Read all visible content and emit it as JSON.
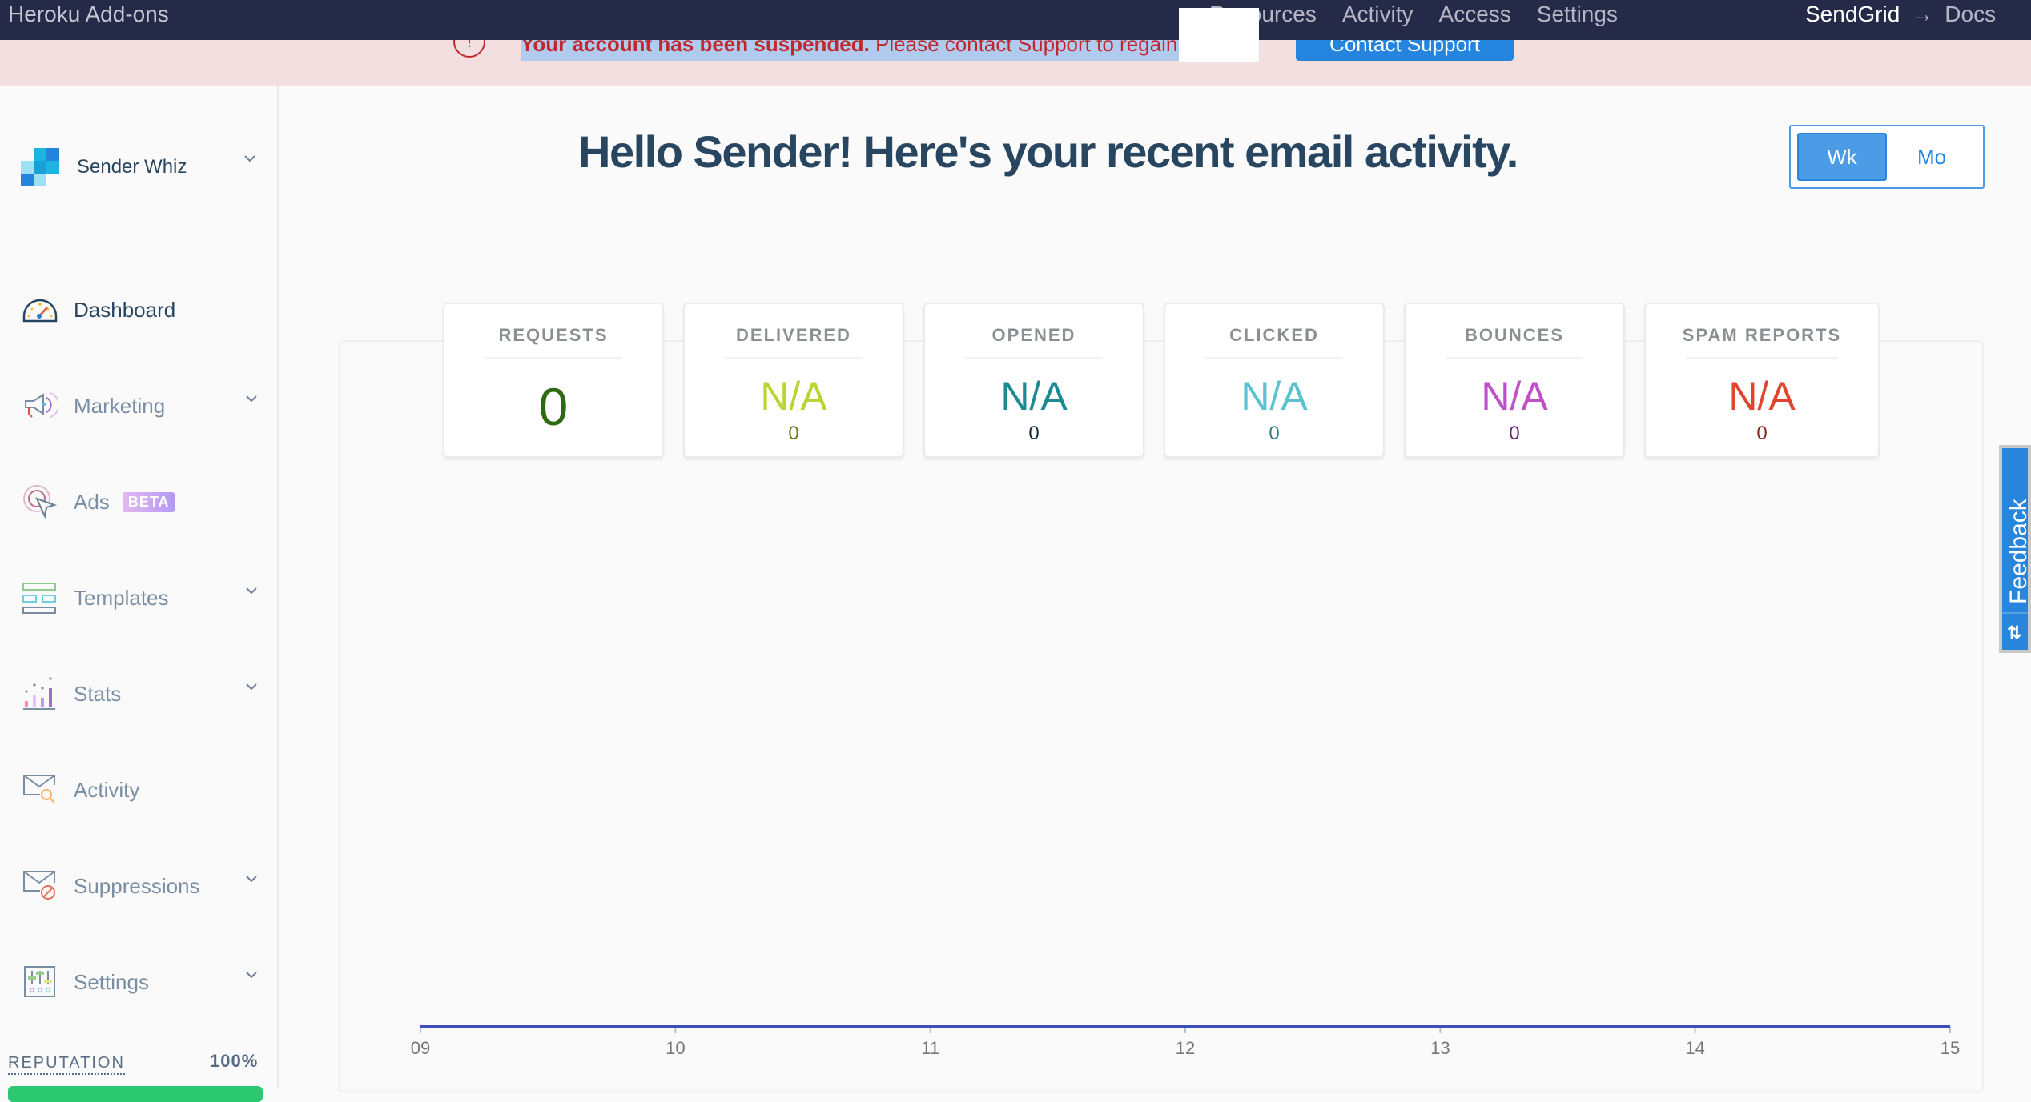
{
  "topbar": {
    "brand": "Heroku Add-ons",
    "nav": [
      "Resources",
      "Activity",
      "Access",
      "Settings"
    ],
    "arrow": "→",
    "addon": "SendGrid",
    "docs": "Docs"
  },
  "banner": {
    "message_bold": "Your account has been suspended.",
    "message_rest": " Please contact Support to regain",
    "contact_button": "Contact Support"
  },
  "sidebar": {
    "account_name": "Sender Whiz",
    "items": [
      {
        "label": "Dashboard",
        "icon": "gauge-icon",
        "active": true,
        "expandable": false
      },
      {
        "label": "Marketing",
        "icon": "megaphone-icon",
        "active": false,
        "expandable": true
      },
      {
        "label": "Ads",
        "icon": "target-cursor-icon",
        "active": false,
        "expandable": false,
        "badge": "BETA"
      },
      {
        "label": "Templates",
        "icon": "template-icon",
        "active": false,
        "expandable": true
      },
      {
        "label": "Stats",
        "icon": "bar-chart-icon",
        "active": false,
        "expandable": true
      },
      {
        "label": "Activity",
        "icon": "mail-search-icon",
        "active": false,
        "expandable": false
      },
      {
        "label": "Suppressions",
        "icon": "mail-block-icon",
        "active": false,
        "expandable": true
      },
      {
        "label": "Settings",
        "icon": "sliders-icon",
        "active": false,
        "expandable": true
      }
    ],
    "reputation": {
      "label": "REPUTATION",
      "value": "100%",
      "percent": 100,
      "color": "#2bc771"
    }
  },
  "main": {
    "title": "Hello Sender! Here's your recent email activity.",
    "toggle": {
      "options": [
        "Wk",
        "Mo"
      ],
      "selected": "Wk"
    },
    "cards": [
      {
        "label": "REQUESTS",
        "value": "0",
        "count": null,
        "color": "#2d6a12"
      },
      {
        "label": "DELIVERED",
        "value": "N/A",
        "count": "0",
        "color": "#bcd335",
        "count_color": "#6b7a1f"
      },
      {
        "label": "OPENED",
        "value": "N/A",
        "count": "0",
        "color": "#1b8a93",
        "count_color": "#142c35"
      },
      {
        "label": "CLICKED",
        "value": "N/A",
        "count": "0",
        "color": "#5bc3cf",
        "count_color": "#2f7c84"
      },
      {
        "label": "BOUNCES",
        "value": "N/A",
        "count": "0",
        "color": "#c04fc9",
        "count_color": "#6b2a70"
      },
      {
        "label": "SPAM REPORTS",
        "value": "N/A",
        "count": "0",
        "color": "#e0452f",
        "count_color": "#8a2a20"
      }
    ]
  },
  "feedback": {
    "label": "Feedback",
    "icon": "sort-arrows-icon"
  },
  "chart_data": {
    "type": "line",
    "title": "",
    "xlabel": "",
    "ylabel": "",
    "categories": [
      "09",
      "10",
      "11",
      "12",
      "13",
      "14",
      "15"
    ],
    "series": [
      {
        "name": "Requests",
        "values": [
          0,
          0,
          0,
          0,
          0,
          0,
          0
        ],
        "color": "#3f4dbf"
      }
    ],
    "ylim": [
      0,
      1
    ],
    "grid": false,
    "legend": "none"
  }
}
